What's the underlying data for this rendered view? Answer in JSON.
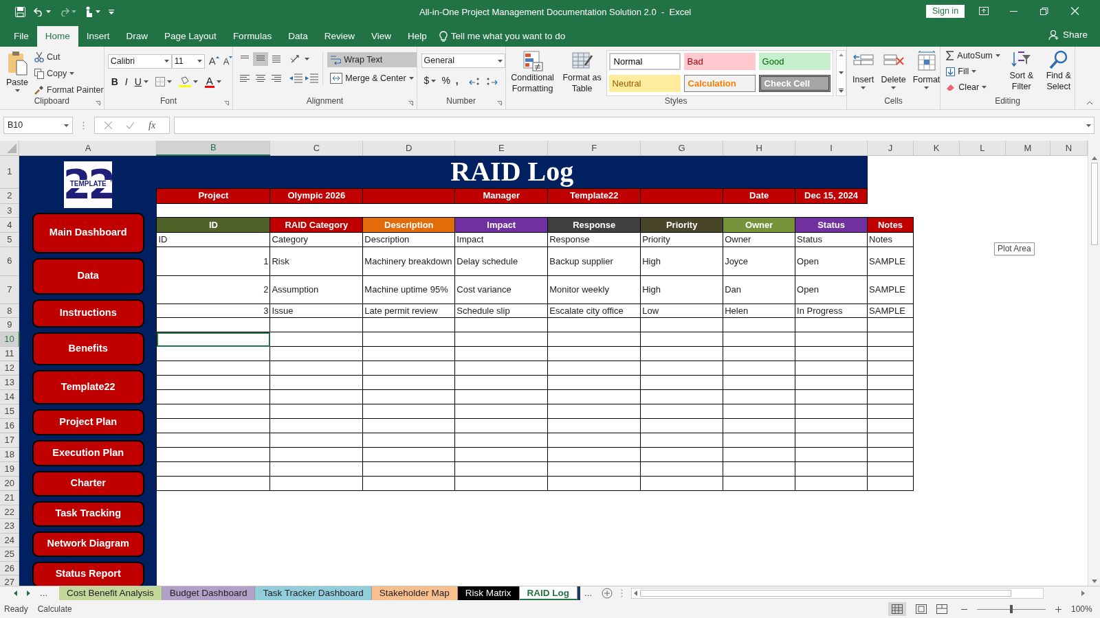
{
  "window": {
    "title": "All-in-One Project Management Documentation Solution 2.0  -  Excel",
    "sign_in": "Sign in"
  },
  "ribbon_tabs": [
    {
      "label": "File",
      "selected": false
    },
    {
      "label": "Home",
      "selected": true
    },
    {
      "label": "Insert",
      "selected": false
    },
    {
      "label": "Draw",
      "selected": false
    },
    {
      "label": "Page Layout",
      "selected": false
    },
    {
      "label": "Formulas",
      "selected": false
    },
    {
      "label": "Data",
      "selected": false
    },
    {
      "label": "Review",
      "selected": false
    },
    {
      "label": "View",
      "selected": false
    },
    {
      "label": "Help",
      "selected": false
    }
  ],
  "tell_me": "Tell me what you want to do",
  "share": "Share",
  "clipboard": {
    "paste": "Paste",
    "cut": "Cut",
    "copy": "Copy",
    "format_painter": "Format Painter",
    "label": "Clipboard"
  },
  "font": {
    "name": "Calibri",
    "size": "11",
    "grow": "A",
    "shrink": "A",
    "bold": "B",
    "italic": "I",
    "underline": "U",
    "font_color": "A",
    "label": "Font"
  },
  "alignment": {
    "wrap_text": "Wrap Text",
    "wrap_text_on": true,
    "middle_align_on": true,
    "merge": "Merge & Center",
    "label": "Alignment"
  },
  "number": {
    "format": "General",
    "currency": "$",
    "percent": "%",
    "comma": ",",
    "label": "Number"
  },
  "styles": {
    "conditional": "Conditional Formatting",
    "format_table": "Format as Table",
    "label": "Styles",
    "cells": [
      {
        "label": "Normal",
        "kind": "normal"
      },
      {
        "label": "Bad",
        "kind": "bad"
      },
      {
        "label": "Good",
        "kind": "good"
      },
      {
        "label": "Neutral",
        "kind": "neutral"
      },
      {
        "label": "Calculation",
        "kind": "calculation"
      },
      {
        "label": "Check Cell",
        "kind": "check"
      }
    ]
  },
  "cells_group": {
    "insert": "Insert",
    "delete": "Delete",
    "format": "Format",
    "label": "Cells"
  },
  "editing": {
    "autosum": "AutoSum",
    "fill": "Fill",
    "clear": "Clear",
    "sort": "Sort & Filter",
    "find": "Find & Select",
    "label": "Editing"
  },
  "formula_bar": {
    "name_box": "B10",
    "function_label": "fx"
  },
  "columns": [
    {
      "label": "A",
      "selected": false
    },
    {
      "label": "B",
      "selected": true
    },
    {
      "label": "C",
      "selected": false
    },
    {
      "label": "D",
      "selected": false
    },
    {
      "label": "E",
      "selected": false
    },
    {
      "label": "F",
      "selected": false
    },
    {
      "label": "G",
      "selected": false
    },
    {
      "label": "H",
      "selected": false
    },
    {
      "label": "I",
      "selected": false
    },
    {
      "label": "J",
      "selected": false
    },
    {
      "label": "K",
      "selected": false
    },
    {
      "label": "L",
      "selected": false
    },
    {
      "label": "M",
      "selected": false
    },
    {
      "label": "N",
      "selected": false
    }
  ],
  "rows": [
    {
      "label": "1",
      "selected": false
    },
    {
      "label": "2",
      "selected": false
    },
    {
      "label": "3",
      "selected": false
    },
    {
      "label": "4",
      "selected": false
    },
    {
      "label": "5",
      "selected": false
    },
    {
      "label": "6",
      "selected": false
    },
    {
      "label": "7",
      "selected": false
    },
    {
      "label": "8",
      "selected": false
    },
    {
      "label": "9",
      "selected": false
    },
    {
      "label": "10",
      "selected": true
    },
    {
      "label": "11",
      "selected": false
    },
    {
      "label": "12",
      "selected": false
    },
    {
      "label": "13",
      "selected": false
    },
    {
      "label": "14",
      "selected": false
    },
    {
      "label": "15",
      "selected": false
    },
    {
      "label": "16",
      "selected": false
    },
    {
      "label": "17",
      "selected": false
    },
    {
      "label": "18",
      "selected": false
    },
    {
      "label": "19",
      "selected": false
    },
    {
      "label": "20",
      "selected": false
    },
    {
      "label": "21",
      "selected": false
    },
    {
      "label": "22",
      "selected": false
    },
    {
      "label": "23",
      "selected": false
    },
    {
      "label": "24",
      "selected": false
    },
    {
      "label": "25",
      "selected": false
    },
    {
      "label": "26",
      "selected": false
    },
    {
      "label": "27",
      "selected": false
    }
  ],
  "sidebar": {
    "logo_number": "22",
    "logo_text": "TEMPLATE",
    "buttons": [
      "Main Dashboard",
      "Data",
      "Instructions",
      "Benefits",
      "Template22",
      "Project Plan",
      "Execution Plan",
      "Charter",
      "Task Tracking",
      "Network Diagram",
      "Status Report"
    ]
  },
  "sheet": {
    "title": "RAID Log",
    "info": [
      {
        "label": "Project",
        "value": "Olympic 2026"
      },
      {
        "label": "Manager",
        "value": "Template22"
      },
      {
        "label": "Date",
        "value": "Dec 15, 2024"
      }
    ],
    "headers": [
      {
        "label": "ID",
        "color": "#4f6228"
      },
      {
        "label": "RAID Category",
        "color": "#c00000"
      },
      {
        "label": "Description",
        "color": "#e26b0a"
      },
      {
        "label": "Impact",
        "color": "#7030a0"
      },
      {
        "label": "Response",
        "color": "#404040"
      },
      {
        "label": "Priority",
        "color": "#494529"
      },
      {
        "label": "Owner",
        "color": "#76933c"
      },
      {
        "label": "Status",
        "color": "#7030a0"
      },
      {
        "label": "Notes",
        "color": "#c00000"
      }
    ],
    "rows": [
      {
        "kind": "label",
        "cells": [
          "ID",
          "Category",
          "Description",
          "Impact",
          "Response",
          "Priority",
          "Owner",
          "Status",
          "Notes"
        ]
      },
      {
        "kind": "entry",
        "cells": [
          "1",
          "Risk",
          "Machinery breakdown",
          "Delay schedule",
          "Backup supplier",
          "High",
          "Joyce",
          "Open",
          "SAMPLE"
        ]
      },
      {
        "kind": "entry",
        "cells": [
          "2",
          "Assumption",
          "Machine uptime 95%",
          "Cost variance",
          "Monitor weekly",
          "High",
          "Dan",
          "Open",
          "SAMPLE"
        ]
      },
      {
        "kind": "entry",
        "cells": [
          "3",
          "Issue",
          "Late permit review",
          "Schedule slip",
          "Escalate city office",
          "Low",
          "Helen",
          "In Progress",
          "SAMPLE"
        ]
      }
    ]
  },
  "tooltip": "Plot Area",
  "sheet_tabs": {
    "more_left": "...",
    "more_right": "...",
    "tabs": [
      {
        "label": "Cost Benefit Analysis",
        "color": "#c4d79b",
        "selected": false
      },
      {
        "label": "Budget Dashboard",
        "color": "#b1a0c7",
        "selected": false
      },
      {
        "label": "Task Tracker Dashboard",
        "color": "#92cddc",
        "selected": false
      },
      {
        "label": "Stakeholder Map",
        "color": "#fabf8f",
        "selected": false
      },
      {
        "label": "Risk Matrix",
        "color": "#000000",
        "selected": false
      },
      {
        "label": "RAID Log",
        "color": "#ffffff",
        "selected": true
      }
    ]
  },
  "status_bar": {
    "items": [
      "Ready",
      "Calculate"
    ],
    "zoom": "100%"
  },
  "zoom_slider": {
    "level": 0.5
  }
}
